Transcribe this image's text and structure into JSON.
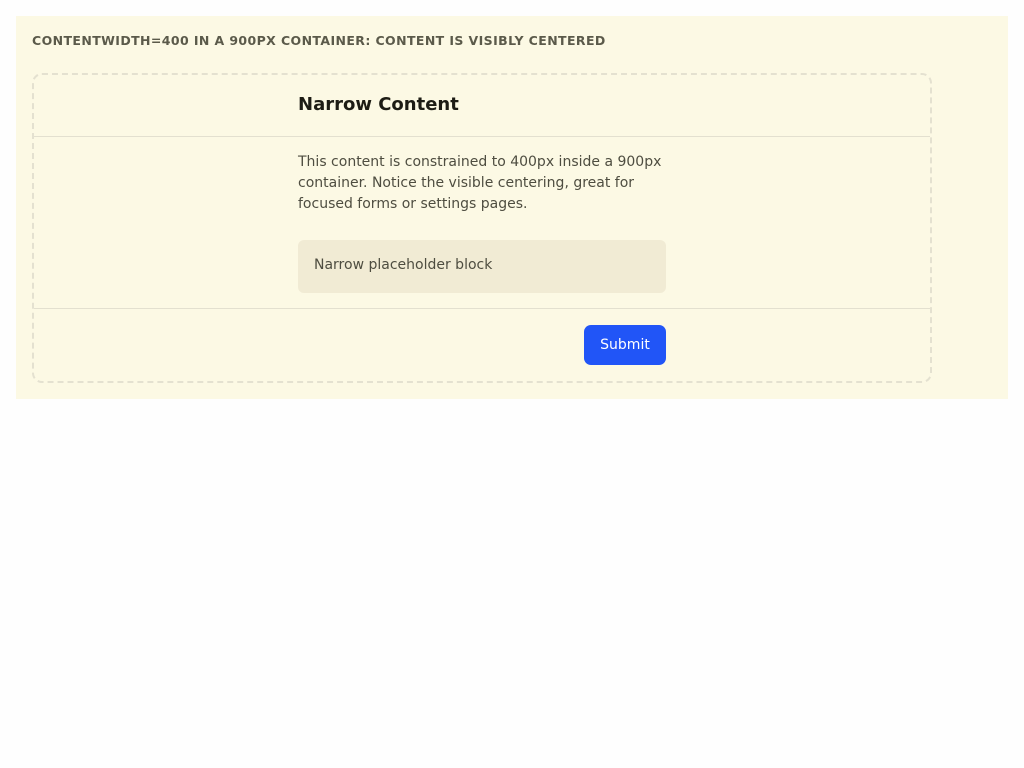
{
  "caption": "CONTENTWIDTH=400 IN A 900PX CONTAINER: CONTENT IS VISIBLY CENTERED",
  "card": {
    "title": "Narrow Content",
    "description": "This content is constrained to 400px inside a 900px container. Notice the visible centering, great for focused forms or settings pages.",
    "placeholder_text": "Narrow placeholder block",
    "submit_label": "Submit"
  },
  "colors": {
    "stage_background": "#fcf9e4",
    "placeholder_background": "#f1ebd4",
    "accent": "#2155f7"
  }
}
